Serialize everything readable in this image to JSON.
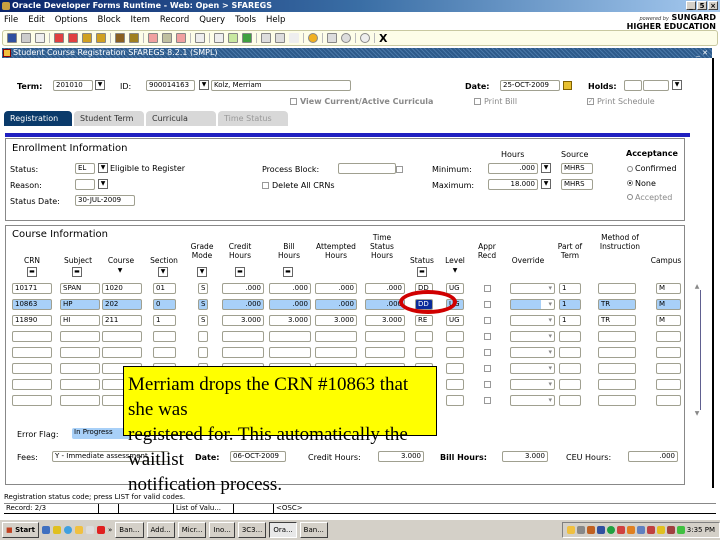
{
  "window": {
    "title": "Oracle Developer Forms Runtime - Web: Open > SFAREGS"
  },
  "menu": [
    "File",
    "Edit",
    "Options",
    "Block",
    "Item",
    "Record",
    "Query",
    "Tools",
    "Help"
  ],
  "brand": {
    "powered_by": "powered by",
    "name": "SUNGARD",
    "sub": "HIGHER EDUCATION"
  },
  "form": {
    "title": "Student Course Registration  SFAREGS  8.2.1  (SMPL)"
  },
  "key": {
    "term_label": "Term:",
    "term": "201010",
    "id_label": "ID:",
    "id": "900014163",
    "name": "Kolz, Merriam",
    "date_label": "Date:",
    "date": "25-OCT-2009",
    "holds_label": "Holds:",
    "view_curricula": "View Current/Active Curricula",
    "print_bill": "Print Bill",
    "print_schedule": "Print Schedule"
  },
  "tabs": [
    {
      "label": "Registration",
      "active": true
    },
    {
      "label": "Student Term"
    },
    {
      "label": "Curricula"
    },
    {
      "label": "Time Status",
      "disabled": true
    }
  ],
  "enrollment": {
    "title": "Enrollment Information",
    "status_label": "Status:",
    "status_code": "EL",
    "status_desc": "Eligible to Register",
    "reason_label": "Reason:",
    "status_date_label": "Status Date:",
    "status_date": "30-JUL-2009",
    "process_block_label": "Process Block:",
    "delete_all_crns": "Delete All CRNs",
    "hours_hdr": "Hours",
    "source_hdr": "Source",
    "minimum_label": "Minimum:",
    "minimum": ".000",
    "min_source": "MHRS",
    "maximum_label": "Maximum:",
    "maximum": "18.000",
    "max_source": "MHRS",
    "acceptance_hdr": "Acceptance",
    "acceptance_options": [
      "Confirmed",
      "None",
      "Accepted"
    ],
    "acceptance_selected": "None"
  },
  "course": {
    "title": "Course Information",
    "headers": {
      "crn": "CRN",
      "subject": "Subject",
      "course": "Course",
      "section": "Section",
      "grade_mode": "Grade Mode",
      "credit_hours": "Credit Hours",
      "bill_hours": "Bill Hours",
      "attempted_hours": "Attempted Hours",
      "time_status_hours": "Time Status Hours",
      "status": "Status",
      "level": "Level",
      "appr_recd": "Appr Recd",
      "override": "Override",
      "part_of_term": "Part of Term",
      "method": "Method of Instruction",
      "campus": "Campus"
    },
    "rows": [
      {
        "crn": "10171",
        "subject": "SPAN",
        "course": "1020",
        "section": "01",
        "grade_mode": "S",
        "credit": ".000",
        "bill": ".000",
        "attempted": ".000",
        "tsh": ".000",
        "status": "DD",
        "level": "UG",
        "part": "1",
        "method": "",
        "campus": "M"
      },
      {
        "crn": "10863",
        "subject": "HP",
        "course": "202",
        "section": "0",
        "grade_mode": "S",
        "credit": ".000",
        "bill": ".000",
        "attempted": ".000",
        "tsh": ".000",
        "status": "DD",
        "level": "UG",
        "part": "1",
        "method": "TR",
        "campus": "M"
      },
      {
        "crn": "11890",
        "subject": "HI",
        "course": "211",
        "section": "1",
        "grade_mode": "S",
        "credit": "3.000",
        "bill": "3.000",
        "attempted": "3.000",
        "tsh": "3.000",
        "status": "RE",
        "level": "UG",
        "part": "1",
        "method": "TR",
        "campus": "M"
      }
    ]
  },
  "footer": {
    "error_flag_label": "Error Flag:",
    "error_flag": "In Progress",
    "fees_label": "Fees:",
    "fees": "Y - Immediate assessment",
    "date_label": "Date:",
    "date": "06-OCT-2009",
    "credit_hours_label": "Credit Hours:",
    "credit_hours": "3.000",
    "bill_hours_label": "Bill Hours:",
    "bill_hours": "3.000",
    "ceu_hours_label": "CEU Hours:",
    "ceu_hours": ".000"
  },
  "callout": {
    "lines": [
      "Merriam drops the CRN #10863 that she was",
      "registered for.  This automatically the waitlist",
      "notification process."
    ]
  },
  "status": {
    "hint": "Registration status code; press LIST for valid codes.",
    "record": "Record: 2/3",
    "lov": "List of Valu...",
    "osc": "<OSC>"
  },
  "taskbar": {
    "start": "Start",
    "buttons": [
      "Ban...",
      "Add...",
      "Micr...",
      "Ino...",
      "3C3...",
      "Ora...",
      "Ban..."
    ],
    "active_index": 5,
    "clock": "3:35 PM"
  }
}
